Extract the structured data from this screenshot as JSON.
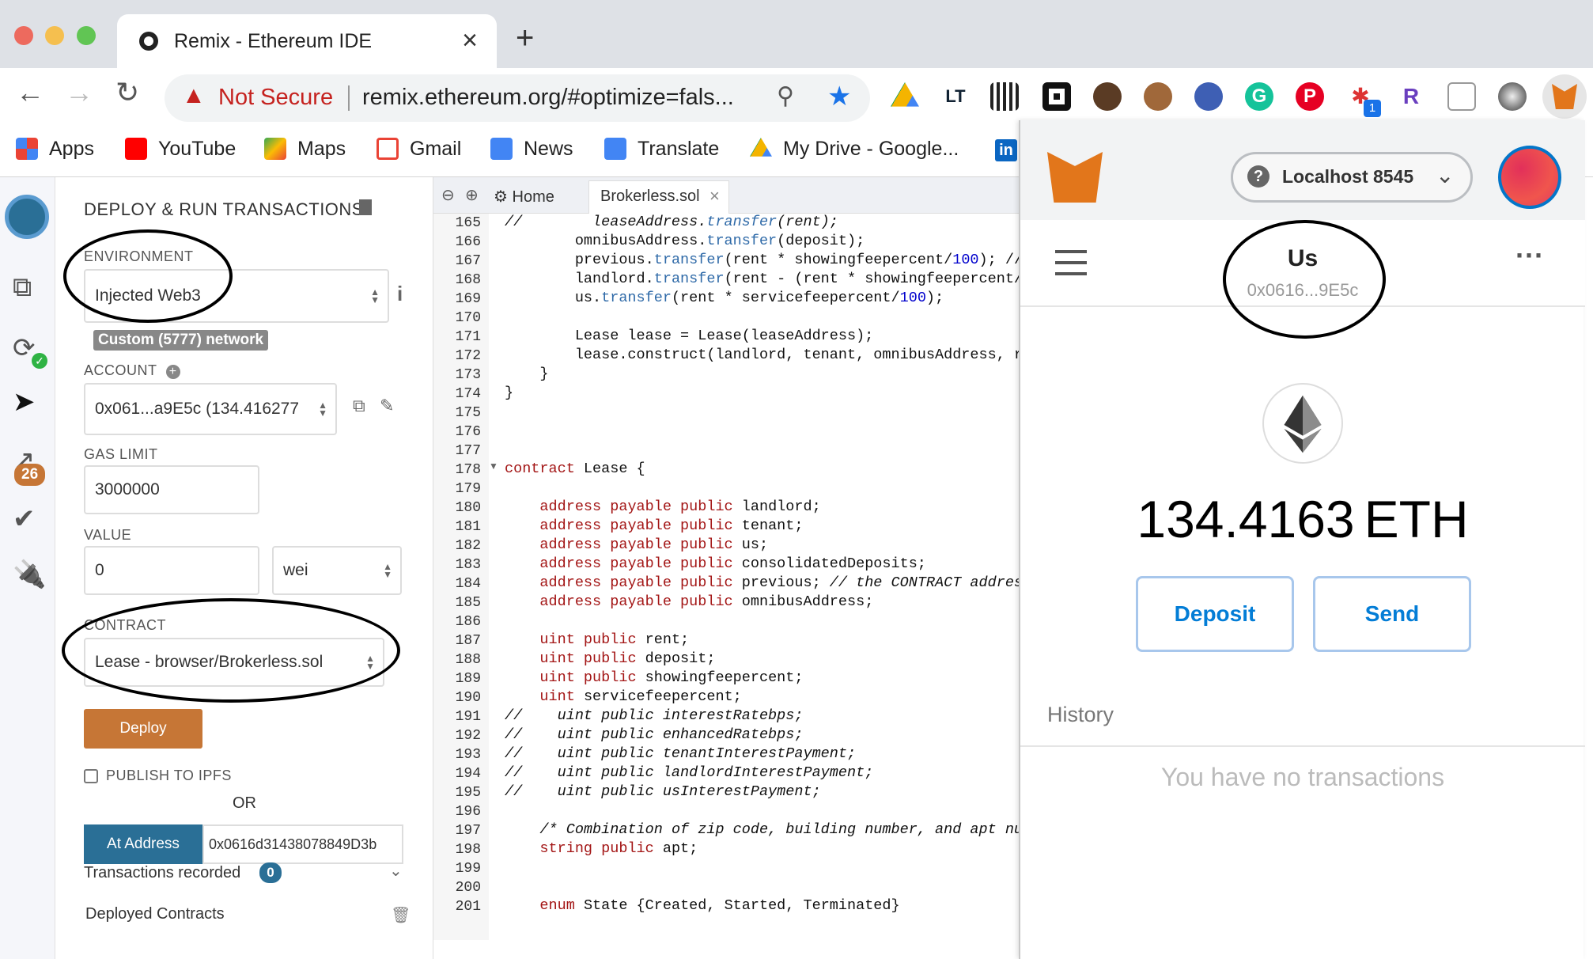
{
  "browser": {
    "tab_title": "Remix - Ethereum IDE",
    "not_secure": "Not Secure",
    "url": "remix.ethereum.org/#optimize=fals...",
    "bookmarks": [
      "Apps",
      "YouTube",
      "Maps",
      "Gmail",
      "News",
      "Translate",
      "My Drive - Google..."
    ]
  },
  "remix": {
    "badge_count": "26",
    "panel_title": "DEPLOY & RUN TRANSACTIONS",
    "environment_label": "ENVIRONMENT",
    "environment_value": "Injected Web3",
    "network_badge": "Custom (5777) network",
    "account_label": "ACCOUNT",
    "account_value": "0x061...a9E5c (134.416277",
    "gas_limit_label": "GAS LIMIT",
    "gas_limit_value": "3000000",
    "value_label": "VALUE",
    "value_value": "0",
    "value_unit": "wei",
    "contract_label": "CONTRACT",
    "contract_value": "Lease - browser/Brokerless.sol",
    "deploy_button": "Deploy",
    "publish_ipfs": "PUBLISH TO IPFS",
    "or": "OR",
    "at_address_button": "At Address",
    "at_address_value": "0x0616d31438078849D3b",
    "transactions_recorded": "Transactions recorded",
    "transactions_count": "0",
    "deployed_contracts": "Deployed Contracts"
  },
  "editor": {
    "home_tab": "Home",
    "file_tab": "Brokerless.sol",
    "line_numbers": [
      "165",
      "166",
      "167",
      "168",
      "169",
      "170",
      "171",
      "172",
      "173",
      "174",
      "175",
      "176",
      "177",
      "178",
      "179",
      "180",
      "181",
      "182",
      "183",
      "184",
      "185",
      "186",
      "187",
      "188",
      "189",
      "190",
      "191",
      "192",
      "193",
      "194",
      "195",
      "196",
      "197",
      "198",
      "199",
      "200",
      "201"
    ]
  },
  "metamask": {
    "network": "Localhost 8545",
    "account_name": "Us",
    "account_address": "0x0616...9E5c",
    "balance_amount": "134.4163",
    "balance_unit": "ETH",
    "deposit_button": "Deposit",
    "send_button": "Send",
    "history_title": "History",
    "no_transactions": "You have no transactions"
  }
}
